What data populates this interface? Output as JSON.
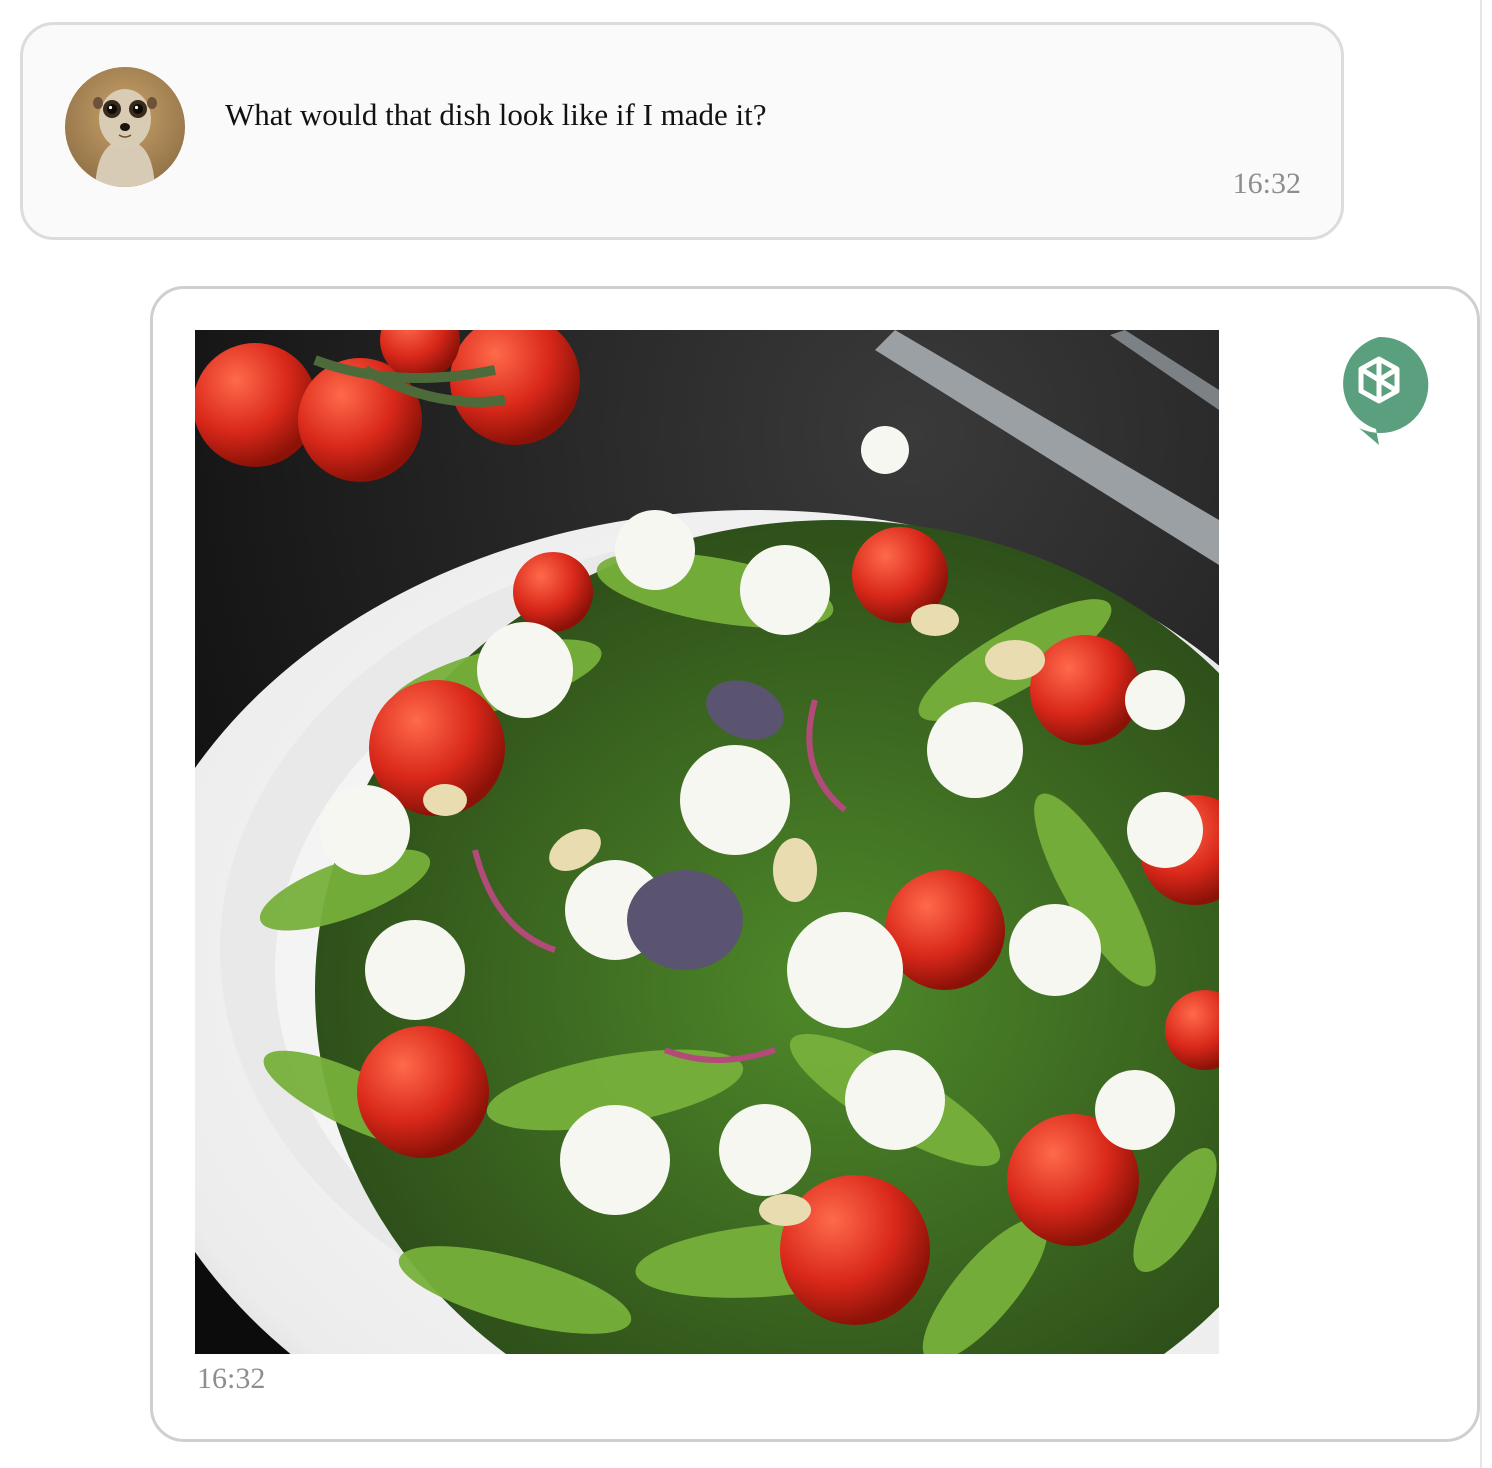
{
  "chat": {
    "messages": [
      {
        "role": "user",
        "avatar_icon": "meerkat-avatar",
        "text": "What would that dish look like if I made it?",
        "time": "16:32"
      },
      {
        "role": "assistant",
        "avatar_icon": "openai-logo-icon",
        "image_subject": "salad-bowl-image",
        "time": "16:32"
      }
    ]
  },
  "colors": {
    "user_bubble_bg": "#fafafa",
    "bubble_border": "#dcdcdc",
    "assistant_icon": "#5a9f7e",
    "timestamp": "#8e8e8e"
  }
}
